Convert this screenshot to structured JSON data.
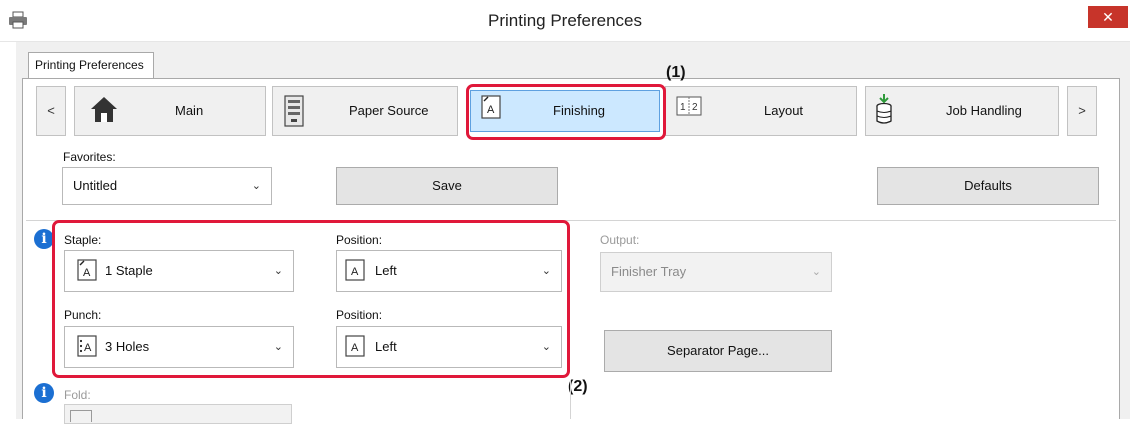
{
  "window": {
    "title": "Printing Preferences",
    "close_label": "✕"
  },
  "tabstrip": {
    "active_tab": "Printing Preferences"
  },
  "nav": {
    "prev": "<",
    "next": ">",
    "tabs": [
      {
        "label": "Main"
      },
      {
        "label": "Paper Source"
      },
      {
        "label": "Finishing"
      },
      {
        "label": "Layout"
      },
      {
        "label": "Job Handling"
      }
    ]
  },
  "callouts": {
    "one": "(1)",
    "two": "(2)"
  },
  "favorites": {
    "label": "Favorites:",
    "value": "Untitled"
  },
  "buttons": {
    "save": "Save",
    "defaults": "Defaults",
    "separator_page": "Separator Page..."
  },
  "staple": {
    "label": "Staple:",
    "value": "1 Staple",
    "position_label": "Position:",
    "position_value": "Left"
  },
  "punch": {
    "label": "Punch:",
    "value": "3 Holes",
    "position_label": "Position:",
    "position_value": "Left"
  },
  "output": {
    "label": "Output:",
    "value": "Finisher Tray"
  },
  "fold": {
    "label": "Fold:"
  },
  "info_glyph": "i",
  "chevron": "⌄",
  "colors": {
    "accent_red": "#e0183a",
    "selected_tab": "#cce8ff",
    "info_blue": "#1b6fd2",
    "close_red": "#c7342a"
  }
}
